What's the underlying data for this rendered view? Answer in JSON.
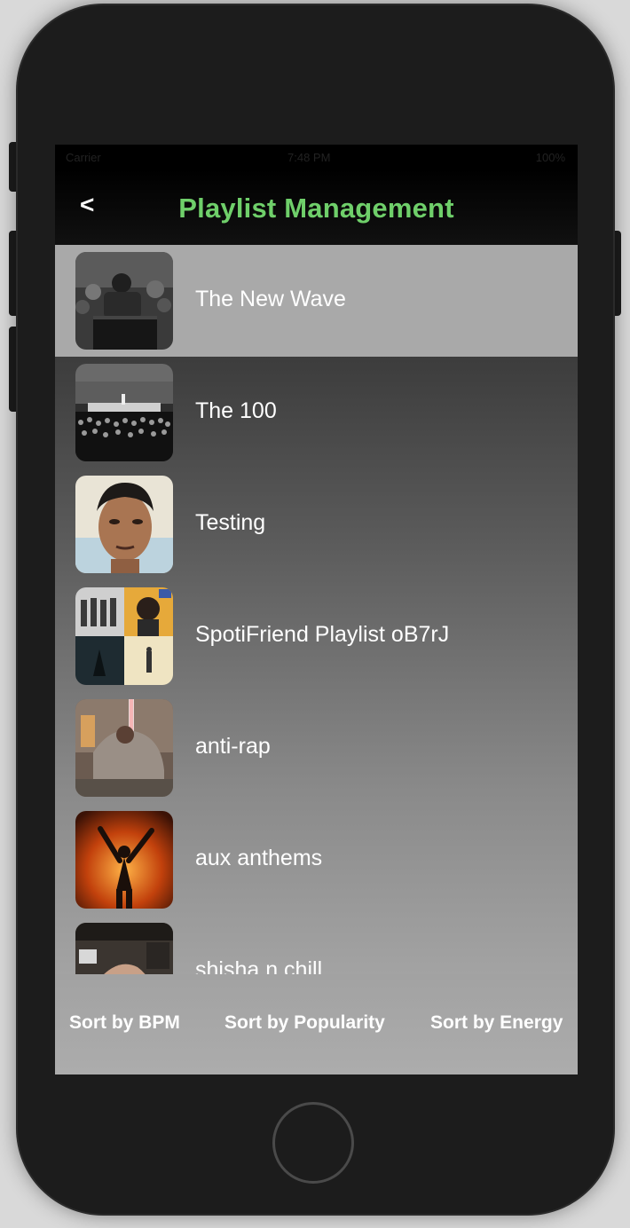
{
  "status_bar": {
    "carrier": "Carrier",
    "time": "7:48 PM",
    "battery": "100%"
  },
  "nav": {
    "back_label": "<",
    "title": "Playlist Management"
  },
  "playlists": [
    {
      "name": "The New Wave",
      "selected": true
    },
    {
      "name": "The 100",
      "selected": false
    },
    {
      "name": "Testing",
      "selected": false
    },
    {
      "name": "SpotiFriend Playlist oB7rJ",
      "selected": false
    },
    {
      "name": "anti-rap",
      "selected": false
    },
    {
      "name": "aux anthems",
      "selected": false
    },
    {
      "name": "shisha n chill",
      "selected": false
    }
  ],
  "sort_buttons": {
    "bpm": "Sort by BPM",
    "popularity": "Sort by Popularity",
    "energy": "Sort by Energy"
  },
  "colors": {
    "title_green": "#6fcf6a",
    "selected_row": "#a9a9a9",
    "nav_bg": "#000000"
  }
}
